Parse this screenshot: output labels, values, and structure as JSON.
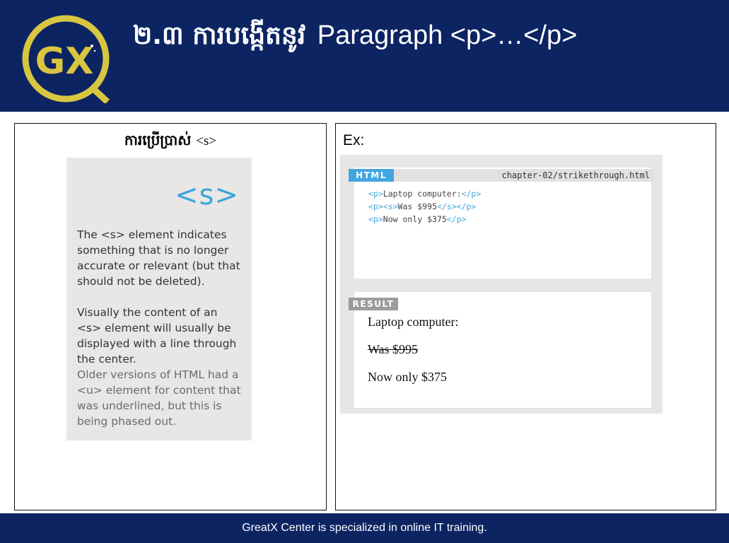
{
  "header": {
    "title_khmer": "២.៣ ការបង្កើតនូវ",
    "title_english": "Paragraph <p>…</p>",
    "logo_text": "GX"
  },
  "left_panel": {
    "title": "ការប្រើប្រាស់",
    "title_tag": "<s>",
    "card": {
      "tag": "<s>",
      "para1": "The <s> element indicates something that is no longer accurate or relevant (but that should not be deleted).",
      "para2": "Visually the content of an <s> element will usually be displayed with a line through the center.",
      "para3": "Older versions of HTML had a <u> element for content that was underlined, but this is being phased out."
    }
  },
  "right_panel": {
    "label": "Ex:",
    "html_badge": "HTML",
    "filename": "chapter-02/strikethrough.html",
    "code_lines": [
      {
        "open": "<p>",
        "text": "Laptop computer:",
        "close": "</p>"
      },
      {
        "open": "<p><s>",
        "text": "Was $995",
        "close": "</s></p>"
      },
      {
        "open": "<p>",
        "text": "Now only $375",
        "close": "</p>"
      }
    ],
    "result_badge": "RESULT",
    "result_lines": [
      "Laptop computer:",
      "Was $995",
      "Now only $375"
    ]
  },
  "footer": {
    "text": "GreatX Center is specialized in online IT training."
  },
  "colors": {
    "header_bg": "#0d2463",
    "accent_blue": "#41a5e0",
    "logo_gold": "#d8c640"
  }
}
